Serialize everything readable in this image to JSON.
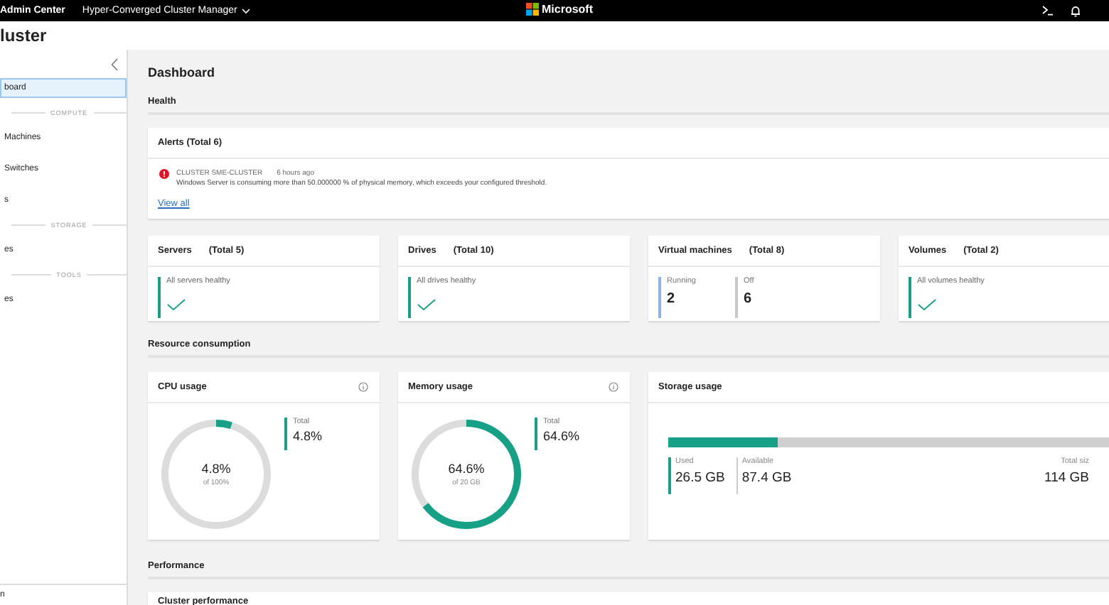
{
  "top_bar": {
    "app_name": "Admin Center",
    "tool_menu": "Hyper-Converged Cluster Manager",
    "brand": "Microsoft"
  },
  "page_title": "luster",
  "sidebar": {
    "items": [
      {
        "kind": "item",
        "label": "board",
        "selected": true
      },
      {
        "kind": "header",
        "label": "COMPUTE"
      },
      {
        "kind": "item",
        "label": "Machines",
        "selected": false
      },
      {
        "kind": "item",
        "label": "Switches",
        "selected": false
      },
      {
        "kind": "item",
        "label": "s",
        "selected": false
      },
      {
        "kind": "header",
        "label": "STORAGE"
      },
      {
        "kind": "item",
        "label": "es",
        "selected": false
      },
      {
        "kind": "header",
        "label": "TOOLS"
      },
      {
        "kind": "item",
        "label": "es",
        "selected": false
      }
    ],
    "footer": "n"
  },
  "dashboard": {
    "title": "Dashboard",
    "health": {
      "heading": "Health",
      "alerts": {
        "title": "Alerts (Total 6)",
        "items": [
          {
            "source": "CLUSTER SME-CLUSTER",
            "time": "6 hours ago",
            "message": "Windows Server is consuming more than 50.000000 % of physical memory, which exceeds your configured threshold."
          }
        ],
        "link": "View all"
      },
      "cards": [
        {
          "kind": "healthy",
          "title": "Servers",
          "total": "(Total 5)",
          "status": "All servers healthy"
        },
        {
          "kind": "healthy",
          "title": "Drives",
          "total": "(Total 10)",
          "status": "All drives healthy"
        },
        {
          "kind": "counts",
          "title": "Virtual machines",
          "total": "(Total 8)",
          "counts": [
            {
              "label": "Running",
              "value": "2",
              "color": "#8ab4e8"
            },
            {
              "label": "Off",
              "value": "6",
              "color": "#c8c8c8"
            }
          ]
        },
        {
          "kind": "healthy",
          "title": "Volumes",
          "total": "(Total 2)",
          "status": "All volumes healthy"
        }
      ]
    },
    "resources": {
      "heading": "Resource consumption",
      "gauges": [
        {
          "title": "CPU usage",
          "level": 0.048,
          "center_value": "4.8%",
          "center_caption": "of 100%",
          "total_label": "Total",
          "total_value": "4.8%"
        },
        {
          "title": "Memory usage",
          "level": 0.646,
          "center_value": "64.6%",
          "center_caption": "of 20 GB",
          "total_label": "Total",
          "total_value": "64.6%"
        }
      ],
      "storage": {
        "title": "Storage usage",
        "level": 0.232,
        "used_label": "Used",
        "used_value": "26.5 GB",
        "available_label": "Available",
        "available_value": "87.4 GB",
        "total_label": "Total siz",
        "total_value": "114 GB"
      }
    },
    "performance": {
      "heading": "Performance",
      "card_title": "Cluster performance"
    }
  }
}
